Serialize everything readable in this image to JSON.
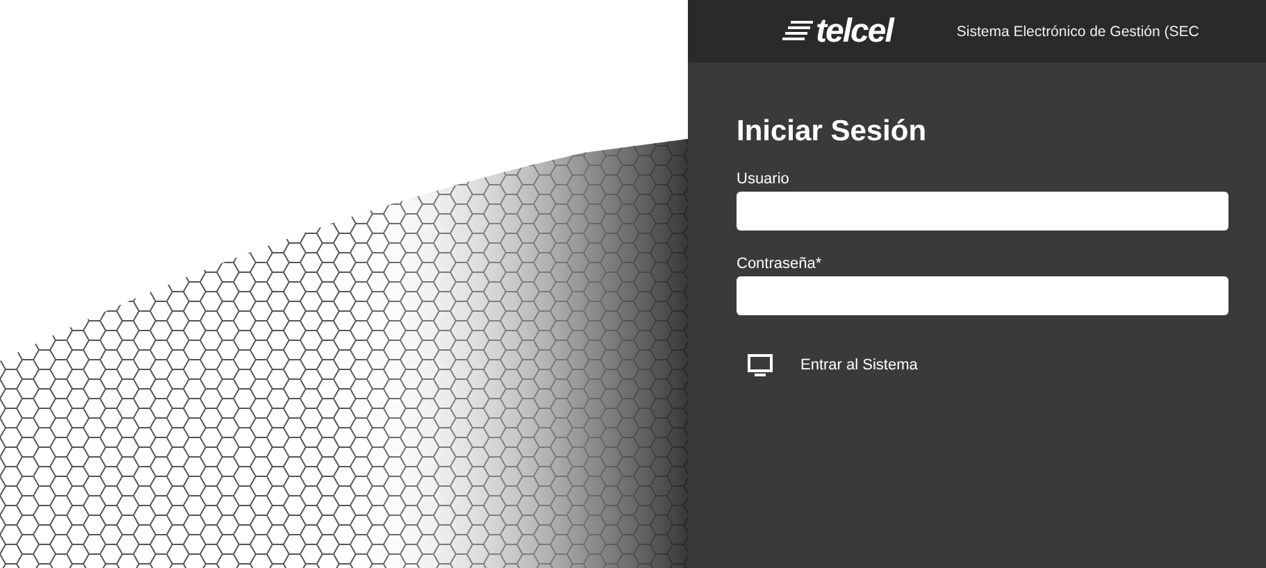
{
  "header": {
    "logo": "telcel",
    "system_title": "Sistema Electrónico de Gestión (SEC"
  },
  "login": {
    "title": "Iniciar Sesión",
    "fields": [
      {
        "label": "Usuario"
      },
      {
        "label": "Contraseña*"
      }
    ],
    "submit": "Entrar al Sistema"
  }
}
